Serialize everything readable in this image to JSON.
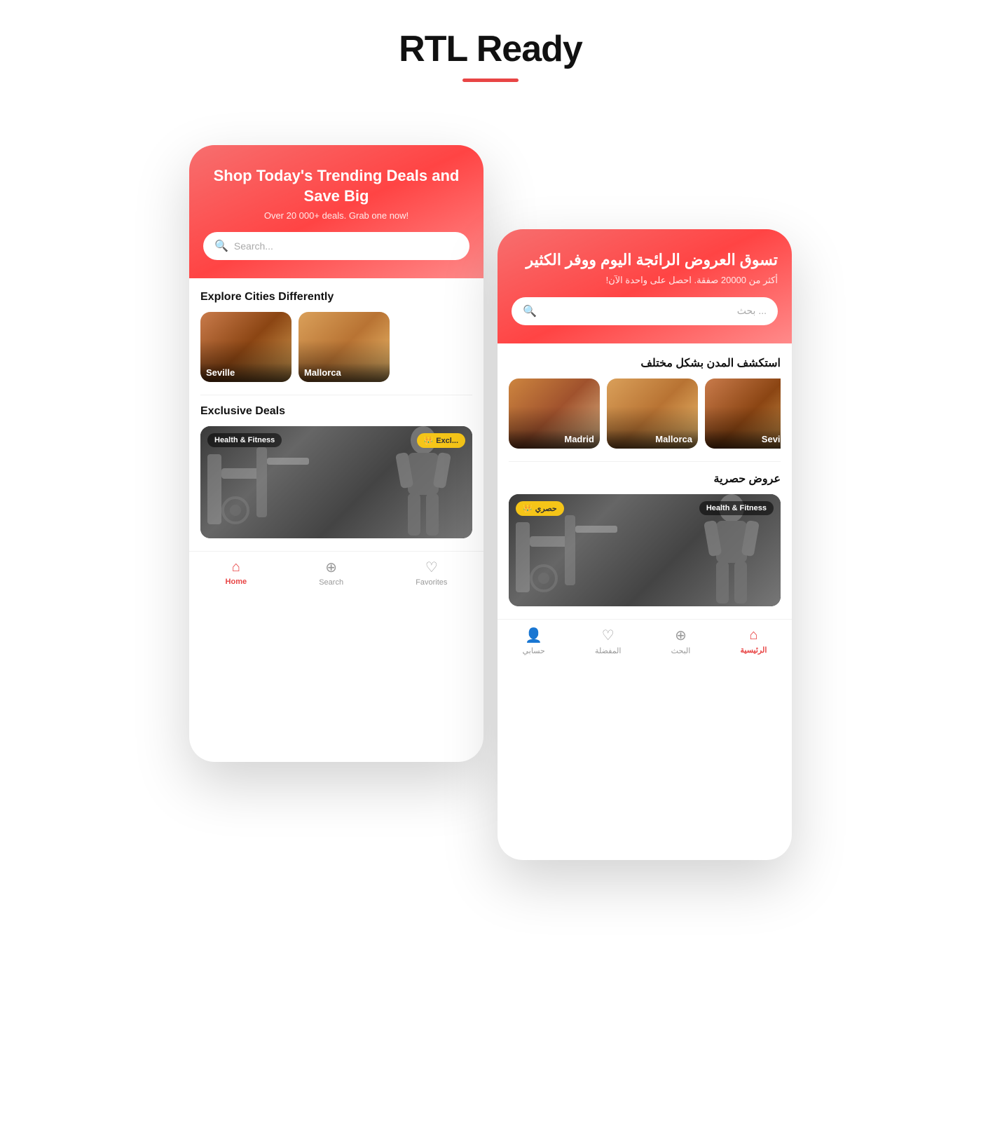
{
  "header": {
    "title": "RTL Ready"
  },
  "ltr_phone": {
    "header": {
      "title": "Shop Today's Trending Deals and Save Big",
      "subtitle": "Over 20 000+ deals. Grab one now!",
      "search_placeholder": "Search..."
    },
    "cities_section": {
      "heading": "Explore Cities Differently",
      "cities": [
        {
          "name": "Seville",
          "color_class": "city-seville"
        },
        {
          "name": "Mallorca",
          "color_class": "city-mallorca"
        }
      ]
    },
    "deals_section": {
      "heading": "Exclusive Deals",
      "badge_category": "Health & Fitness",
      "badge_exclusive": "Excl..."
    },
    "nav": {
      "items": [
        {
          "label": "Home",
          "icon": "⌂",
          "active": true
        },
        {
          "label": "Search",
          "icon": "🔍",
          "active": false
        },
        {
          "label": "Favorites",
          "icon": "♡",
          "active": false
        }
      ]
    }
  },
  "rtl_phone": {
    "header": {
      "title": "تسوق العروض الرائجة اليوم ووفر الكثير",
      "subtitle": "أكثر من 20000 صفقة. احصل على واحدة الآن!",
      "search_placeholder": "... بحث"
    },
    "cities_section": {
      "heading": "استكشف المدن بشكل مختلف",
      "cities": [
        {
          "name": "Madrid",
          "color_class": "city-madrid"
        },
        {
          "name": "Mallorca",
          "color_class": "city-mallorca"
        },
        {
          "name": "Seville",
          "color_class": "city-seville"
        }
      ]
    },
    "deals_section": {
      "heading": "عروض حصرية",
      "badge_category": "Health & Fitness",
      "badge_exclusive": "حصري"
    },
    "nav": {
      "items": [
        {
          "label": "حسابي",
          "icon": "👤",
          "active": false
        },
        {
          "label": "المفضلة",
          "icon": "♡",
          "active": false
        },
        {
          "label": "البحث",
          "icon": "🔍",
          "active": false
        },
        {
          "label": "الرئيسية",
          "icon": "⌂",
          "active": true
        }
      ]
    }
  }
}
